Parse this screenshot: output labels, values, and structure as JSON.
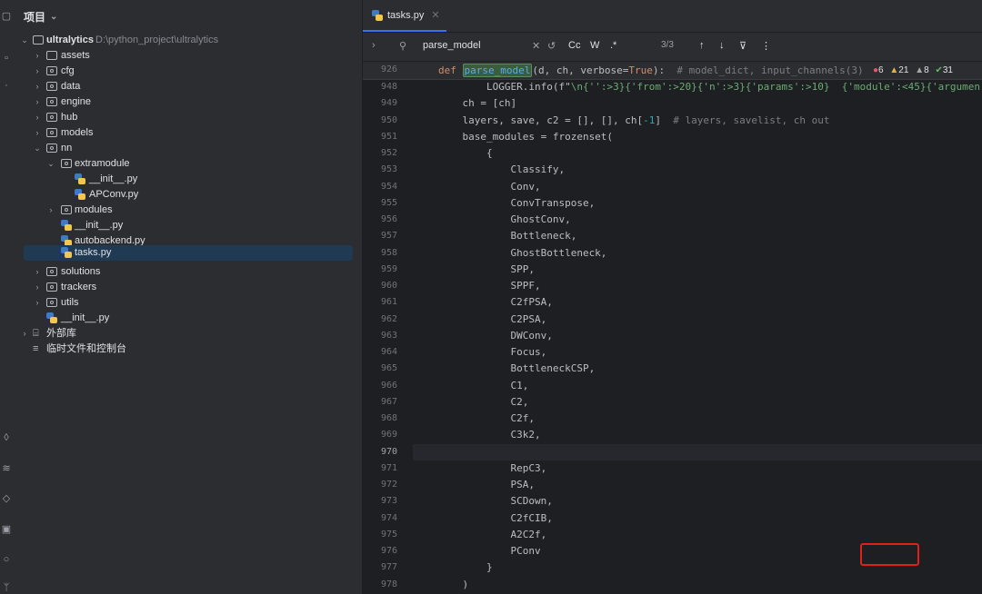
{
  "sidebar_title": "项目",
  "root": {
    "name": "ultralytics",
    "path": "D:\\python_project\\ultralytics"
  },
  "tree": [
    {
      "label": "assets"
    },
    {
      "label": "cfg"
    },
    {
      "label": "data"
    },
    {
      "label": "engine"
    },
    {
      "label": "hub"
    },
    {
      "label": "models"
    },
    {
      "label": "nn"
    },
    {
      "label": "extramodule"
    },
    {
      "label": "__init__.py"
    },
    {
      "label": "APConv.py"
    },
    {
      "label": "modules"
    },
    {
      "label": "__init__.py"
    },
    {
      "label": "autobackend.py"
    },
    {
      "label": "tasks.py"
    },
    {
      "label": "solutions"
    },
    {
      "label": "trackers"
    },
    {
      "label": "utils"
    },
    {
      "label": "__init__.py"
    },
    {
      "label": "外部库"
    },
    {
      "label": "临时文件和控制台"
    }
  ],
  "tab": {
    "label": "tasks.py"
  },
  "find": {
    "query": "parse_model",
    "count": "3/3",
    "case_label": "Cc",
    "word_label": "W",
    "regex_label": ".*"
  },
  "sticky": {
    "line": "926",
    "kw": "def ",
    "fn": "parse_model",
    "args": "(d, ch, verbose=",
    "true_kw": "True",
    "rest": "):",
    "comment": "  # model_dict, input_channels(3)",
    "errors": "6",
    "warnings": "21",
    "weak": "8",
    "ok": "31"
  },
  "code": [
    {
      "n": "948",
      "segs": [
        [
          "        LOGGER.info(f\"",
          "p"
        ],
        [
          "\\n",
          "s"
        ],
        [
          "{'':>3}{'from':>20}{'n':>3}{'params':>10}  {'module':<45}{'argumen",
          "s"
        ]
      ]
    },
    {
      "n": "949",
      "segs": [
        [
          "    ch = [ch]",
          "p"
        ]
      ]
    },
    {
      "n": "950",
      "segs": [
        [
          "    layers, save, c2 = [], [], ch[",
          "p"
        ],
        [
          "-1",
          "n"
        ],
        [
          "]  ",
          "p"
        ],
        [
          "# layers, savelist, ch out",
          "c"
        ]
      ]
    },
    {
      "n": "951",
      "segs": [
        [
          "    base_modules = frozenset(",
          "p"
        ]
      ]
    },
    {
      "n": "952",
      "segs": [
        [
          "        {",
          "p"
        ]
      ]
    },
    {
      "n": "953",
      "segs": [
        [
          "            Classify,",
          "p"
        ]
      ]
    },
    {
      "n": "954",
      "segs": [
        [
          "            Conv,",
          "p"
        ]
      ]
    },
    {
      "n": "955",
      "segs": [
        [
          "            ConvTranspose,",
          "p"
        ]
      ]
    },
    {
      "n": "956",
      "segs": [
        [
          "            GhostConv,",
          "p"
        ]
      ]
    },
    {
      "n": "957",
      "segs": [
        [
          "            Bottleneck,",
          "p"
        ]
      ]
    },
    {
      "n": "958",
      "segs": [
        [
          "            GhostBottleneck,",
          "p"
        ]
      ]
    },
    {
      "n": "959",
      "segs": [
        [
          "            SPP,",
          "p"
        ]
      ]
    },
    {
      "n": "960",
      "segs": [
        [
          "            SPPF,",
          "p"
        ]
      ]
    },
    {
      "n": "961",
      "segs": [
        [
          "            C2fPSA,",
          "p"
        ]
      ]
    },
    {
      "n": "962",
      "segs": [
        [
          "            C2PSA,",
          "p"
        ]
      ]
    },
    {
      "n": "963",
      "segs": [
        [
          "            DWConv,",
          "p"
        ]
      ]
    },
    {
      "n": "964",
      "segs": [
        [
          "            Focus,",
          "p"
        ]
      ]
    },
    {
      "n": "965",
      "segs": [
        [
          "            BottleneckCSP,",
          "p"
        ]
      ]
    },
    {
      "n": "966",
      "segs": [
        [
          "            C1,",
          "p"
        ]
      ]
    },
    {
      "n": "967",
      "segs": [
        [
          "            C2,",
          "p"
        ]
      ]
    },
    {
      "n": "968",
      "segs": [
        [
          "            C2f,",
          "p"
        ]
      ]
    },
    {
      "n": "969",
      "segs": [
        [
          "            C3k2,",
          "p"
        ]
      ]
    },
    {
      "n": "970",
      "segs": [
        [
          "",
          "p"
        ]
      ],
      "cur": true
    },
    {
      "n": "971",
      "segs": [
        [
          "            RepC3,",
          "p"
        ]
      ]
    },
    {
      "n": "972",
      "segs": [
        [
          "            PSA,",
          "p"
        ]
      ]
    },
    {
      "n": "973",
      "segs": [
        [
          "            SCDown,",
          "p"
        ]
      ]
    },
    {
      "n": "974",
      "segs": [
        [
          "            C2fCIB,",
          "p"
        ]
      ]
    },
    {
      "n": "975",
      "segs": [
        [
          "            A2C2f,",
          "p"
        ]
      ]
    },
    {
      "n": "976",
      "segs": [
        [
          "            PConv",
          "p"
        ]
      ]
    },
    {
      "n": "977",
      "segs": [
        [
          "        }",
          "p"
        ]
      ]
    },
    {
      "n": "978",
      "segs": [
        [
          "    )",
          "p"
        ]
      ]
    }
  ]
}
